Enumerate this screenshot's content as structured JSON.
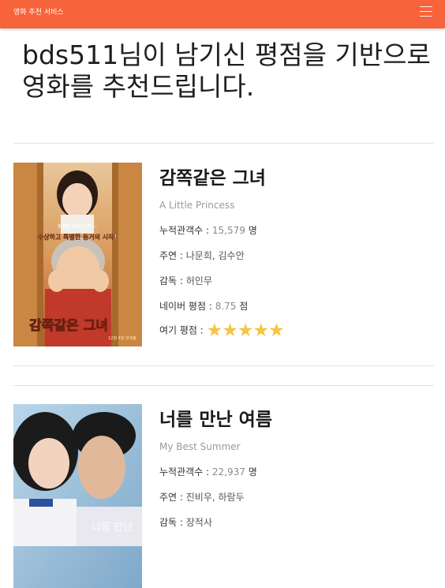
{
  "navbar": {
    "brand": "영화 추천 서비스",
    "menu_icon": "hamburger-menu-icon"
  },
  "headline": "bds511님이 남기신 평점을 기반으로 영화를 추천드립니다.",
  "movies": [
    {
      "title": "감쪽같은 그녀",
      "original_title": "A Little Princess",
      "audience_label": "누적관객수 : ",
      "audience": "15,579",
      "audience_unit": " 명",
      "cast_label": "주연 : ",
      "cast": "나문희, 김수안",
      "director_label": "감독 : ",
      "director": "허인무",
      "naver_label": "네이버 평점 : ",
      "naver_score": "8.75",
      "naver_unit": " 점",
      "site_label": "여기 평점 : ",
      "site_rating": 5,
      "site_stars": "★★★★★",
      "poster": {
        "title_text": "감쪽같은 그녀",
        "tagline": "수상하고 특별한 동거의 시작!",
        "small_text": "초면에 실례합니다~",
        "date_text": "12월 4일 대개봉"
      }
    },
    {
      "title": "너를 만난 여름",
      "original_title": "My Best Summer",
      "audience_label": "누적관객수 : ",
      "audience": "22,937",
      "audience_unit": " 명",
      "cast_label": "주연 : ",
      "cast": "진비우, 하람두",
      "director_label": "감독 : ",
      "director": "장적사",
      "poster": {
        "title_text": "너를 만난"
      }
    }
  ],
  "colors": {
    "navbar": "#f7633a",
    "star": "#f4c542",
    "muted": "#9a9a9a"
  }
}
